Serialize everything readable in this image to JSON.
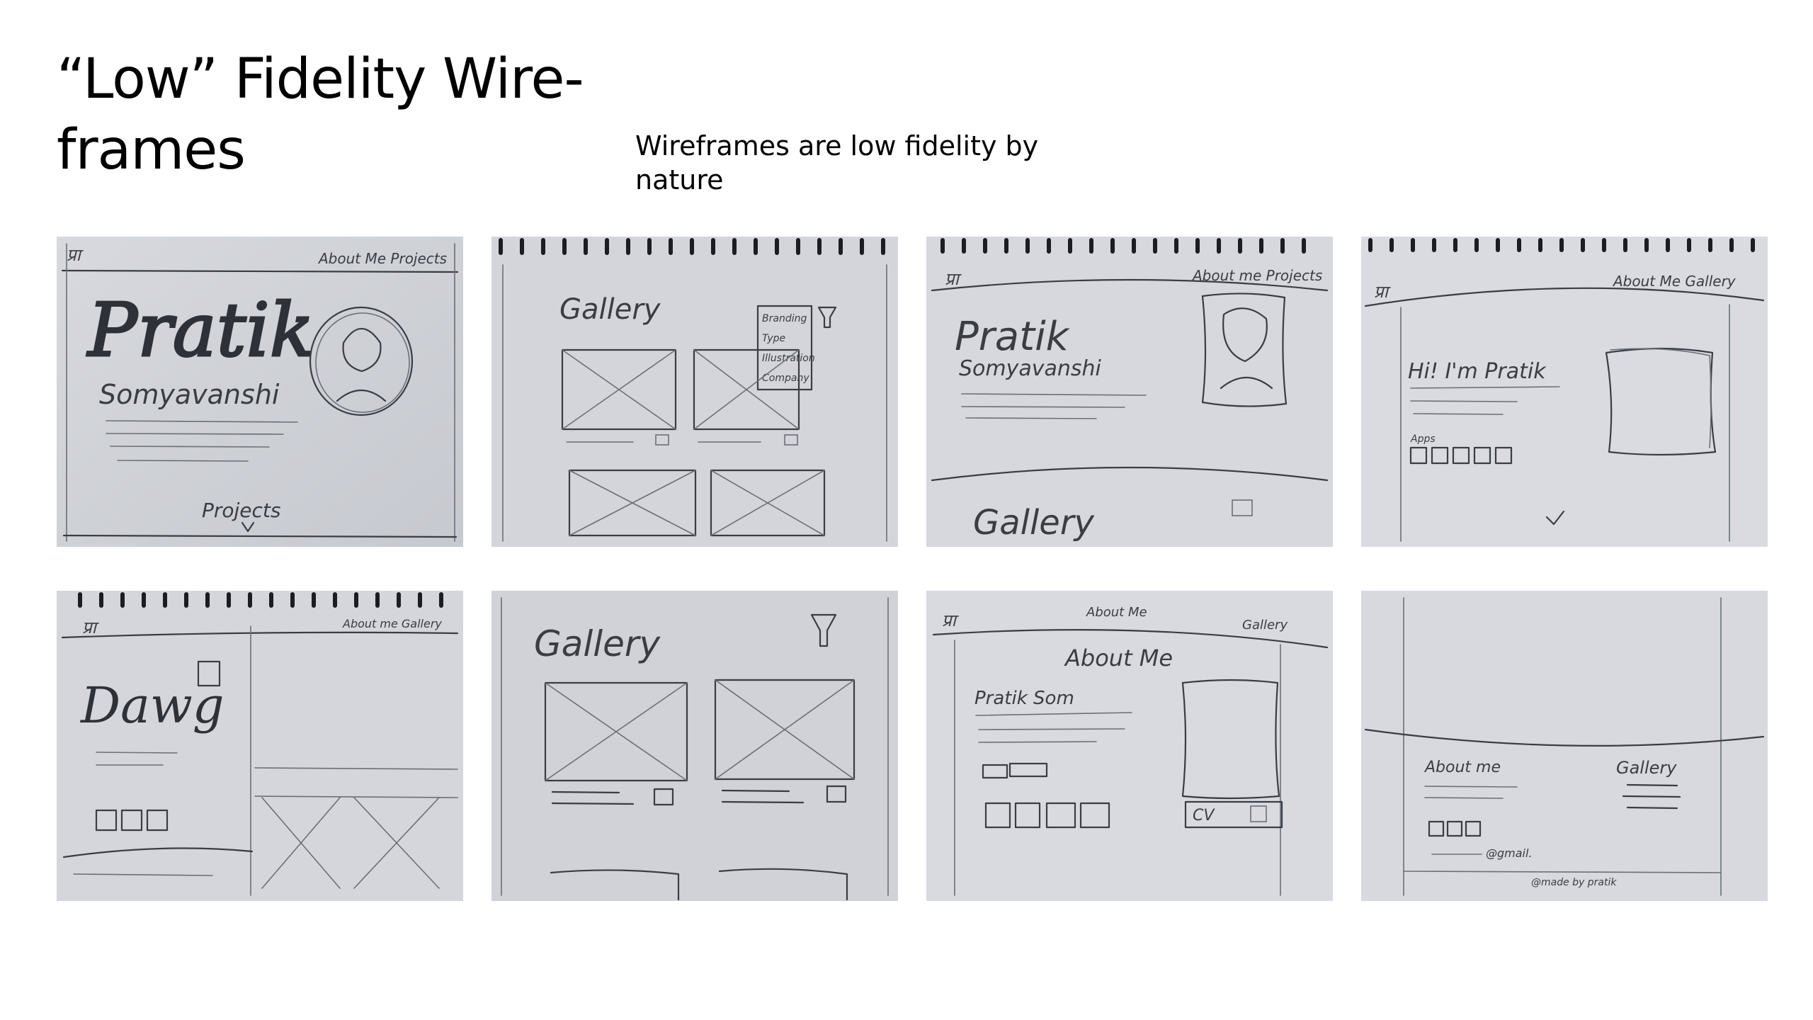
{
  "title": "“Low” Fidelity Wire-frames",
  "subtitle": "Wireframes are low fidelity by nature",
  "sketches": [
    {
      "nav": "About Me Projects",
      "heading": "Pratik",
      "subheading": "Somyavanshi",
      "footer": "Projects"
    },
    {
      "heading": "Gallery",
      "filters": [
        "Branding",
        "Type",
        "Illustration",
        "Company"
      ]
    },
    {
      "nav": "About me Projects",
      "heading": "Pratik",
      "subheading": "Somyavanshi",
      "footer": "Gallery"
    },
    {
      "nav": "About Me Gallery",
      "heading": "Hi! I'm Pratik",
      "label": "Apps"
    },
    {
      "nav": "About me Gallery",
      "heading": "Dawg"
    },
    {
      "heading": "Gallery"
    },
    {
      "nav_left": "About Me",
      "nav_right": "Gallery",
      "heading": "About Me",
      "subheading": "Pratik Som",
      "cv": "CV"
    },
    {
      "left_heading": "About me",
      "right_heading": "Gallery",
      "email": "@gmail.",
      "credit": "@made by pratik"
    }
  ]
}
